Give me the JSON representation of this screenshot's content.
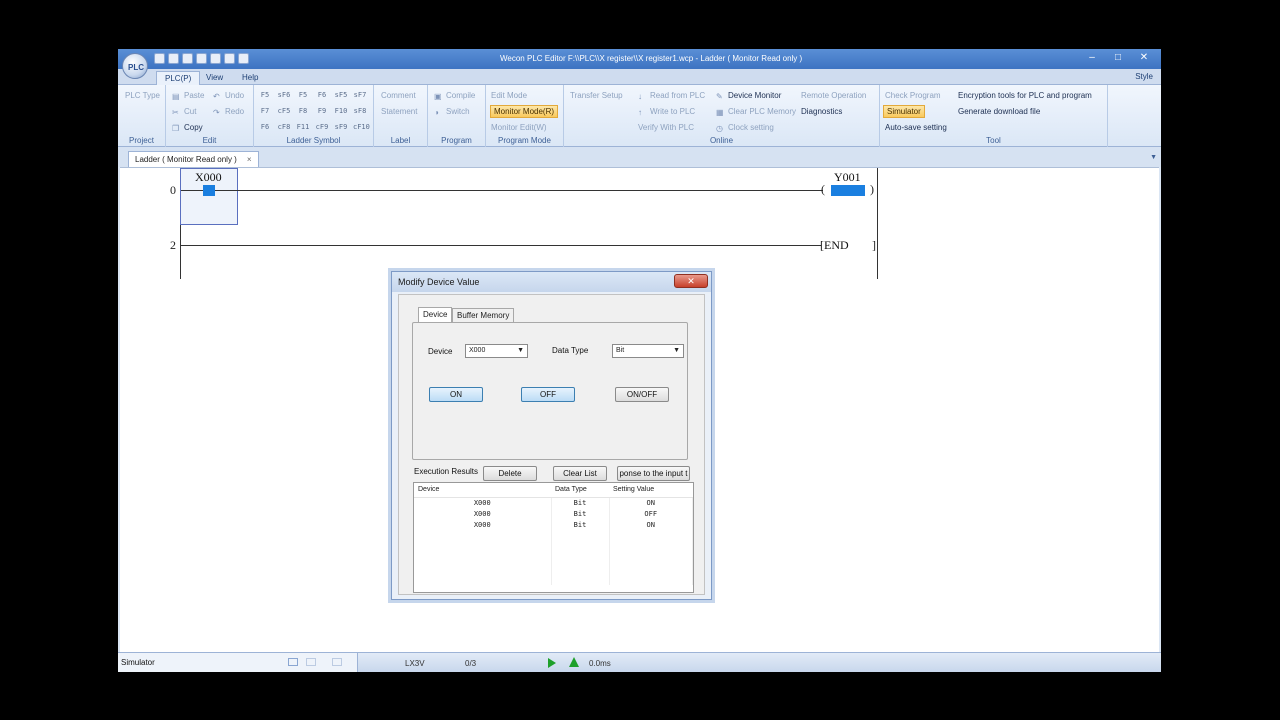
{
  "window": {
    "title": "Wecon PLC Editor  F:\\\\PLC\\\\X register\\\\X register1.wcp  - Ladder ( Monitor Read only )",
    "controls": [
      "–",
      "□",
      "✕"
    ]
  },
  "menu": {
    "tabs": [
      "PLC(P)",
      "View",
      "Help"
    ],
    "active": "PLC(P)",
    "style_label": "Style"
  },
  "ribbon": {
    "project": {
      "label": "Project",
      "plc_type": "PLC Type"
    },
    "edit": {
      "label": "Edit",
      "paste": "Paste",
      "undo": "Undo",
      "cut": "Cut",
      "redo": "Redo",
      "copy": "Copy"
    },
    "ladder_symbol": {
      "label": "Ladder Symbol",
      "symbols": [
        "F5",
        "sF6",
        "F5",
        "F6",
        "sF5",
        "sF7",
        "F7",
        "cF5",
        "F8",
        "F9",
        "F10",
        "sF8",
        "F6",
        "cF8",
        "F11",
        "cF9",
        "sF9",
        "cF10"
      ]
    },
    "label_group": {
      "label": "Label",
      "comment": "Comment",
      "statement": "Statement"
    },
    "program": {
      "label": "Program",
      "compile": "Compile",
      "switch": "Switch"
    },
    "program_mode": {
      "label": "Program Mode",
      "edit_mode": "Edit Mode",
      "monitor_mode": "Monitor Mode(R)",
      "monitor_edit": "Monitor Edit(W)"
    },
    "online": {
      "label": "Online",
      "transfer_setup": "Transfer Setup",
      "read_from_plc": "Read from PLC",
      "write_to_plc": "Write to PLC",
      "verify_with_plc": "Verify With PLC",
      "device_monitor": "Device Monitor",
      "clear_plc_memory": "Clear PLC Memory",
      "clock_setting": "Clock setting",
      "remote_operation": "Remote Operation",
      "diagnostics": "Diagnostics"
    },
    "tool": {
      "label": "Tool",
      "check_program": "Check Program",
      "simulator": "Simulator",
      "auto_save": "Auto-save setting",
      "encryption": "Encryption tools for PLC and program",
      "generate_download": "Generate download file"
    }
  },
  "document_tab": {
    "label": "Ladder ( Monitor Read only )",
    "close": "×"
  },
  "ladder": {
    "rungs": [
      {
        "step": "0",
        "contact": "X000",
        "coil": "Y001"
      },
      {
        "step": "2",
        "end_label": "[END"
      }
    ]
  },
  "dialog": {
    "title": "Modify Device Value",
    "close": "✕",
    "tabs": [
      "Device",
      "Buffer Memory"
    ],
    "device_label": "Device",
    "device_value": "X000",
    "data_type_label": "Data Type",
    "data_type_value": "Bit",
    "buttons": {
      "on": "ON",
      "off": "OFF",
      "onoff": "ON/OFF"
    },
    "execution_results_label": "Execution Results",
    "delete": "Delete",
    "clear_list": "Clear List",
    "response": "ponse to the input t",
    "results_headers": [
      "Device",
      "Data Type",
      "Setting Value"
    ],
    "results_rows": [
      [
        "X000",
        "Bit",
        "ON"
      ],
      [
        "X000",
        "Bit",
        "OFF"
      ],
      [
        "X000",
        "Bit",
        "ON"
      ]
    ]
  },
  "statusbar": {
    "simulator": "Simulator",
    "model": "LX3V",
    "step": "0/3",
    "scan_time": "0.0ms"
  }
}
